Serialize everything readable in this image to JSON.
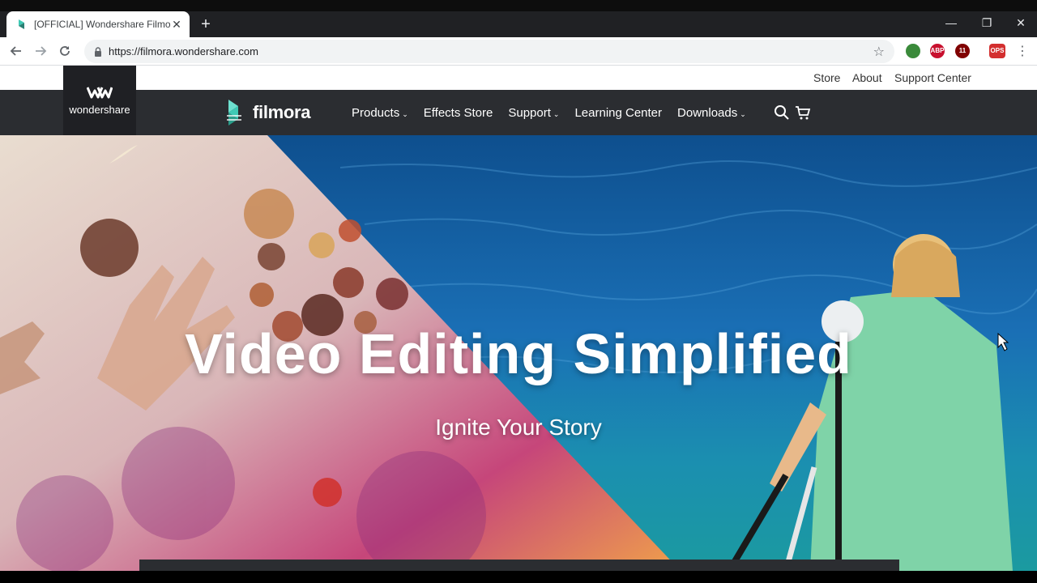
{
  "browser": {
    "tab_title": "[OFFICIAL] Wondershare Filmora",
    "new_tab_symbol": "+",
    "close_tab_symbol": "✕",
    "url": "https://filmora.wondershare.com",
    "window_controls": {
      "minimize": "—",
      "restore": "❐",
      "close": "✕"
    },
    "extensions": [
      {
        "name": "globe-extension-icon",
        "label": "",
        "color": "#3a8a3a"
      },
      {
        "name": "adblock-plus-icon",
        "label": "ABP",
        "color": "#c8102e"
      },
      {
        "name": "ublock-origin-icon",
        "label": "11",
        "color": "#800000"
      },
      {
        "name": "ops-extension-icon",
        "label": "OPS",
        "color": "#d32f2f"
      }
    ]
  },
  "site": {
    "utility_links": [
      "Store",
      "About",
      "Support Center"
    ],
    "wondershare_logo_text": "wondershare",
    "brand_name": "filmora",
    "nav": [
      {
        "label": "Products",
        "dropdown": "⌄"
      },
      {
        "label": "Effects Store",
        "dropdown": ""
      },
      {
        "label": "Support",
        "dropdown": "⌄"
      },
      {
        "label": "Learning Center",
        "dropdown": ""
      },
      {
        "label": "Downloads",
        "dropdown": "⌄"
      }
    ],
    "hero": {
      "title": "Video Editing Simplified",
      "subtitle": "Ignite Your Story"
    },
    "colors": {
      "nav_bg": "#2b2d31",
      "brand_teal": "#3fc9b5",
      "sea_blue": "#1565a8"
    }
  }
}
